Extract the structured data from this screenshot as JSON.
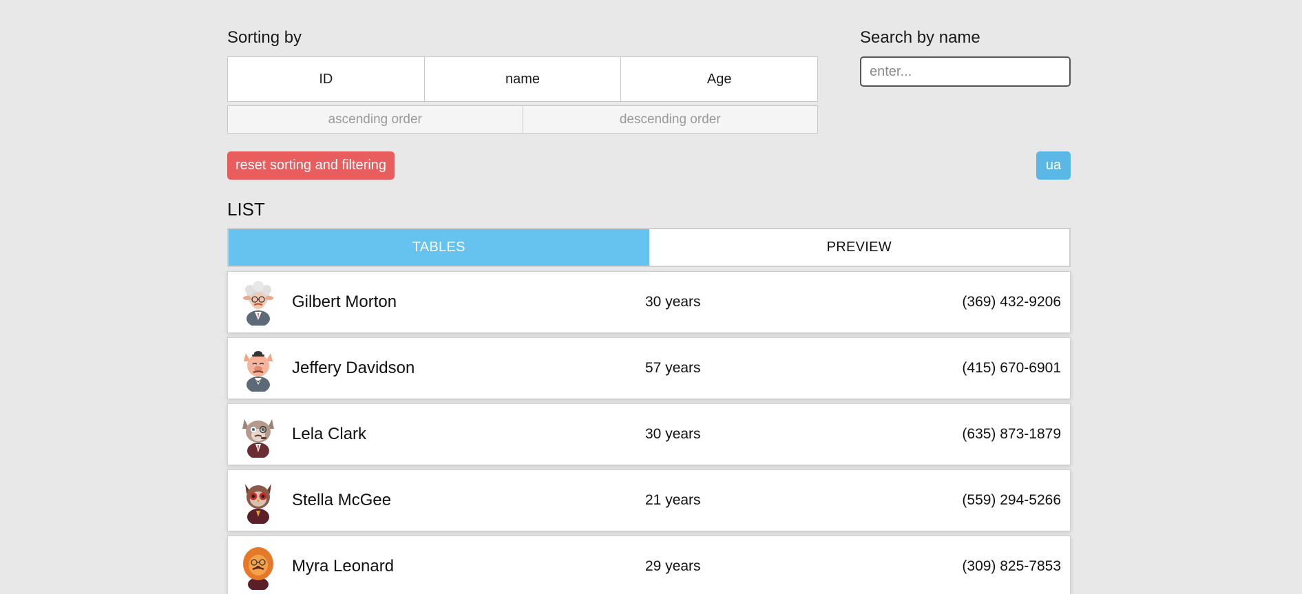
{
  "sorting": {
    "title": "Sorting by",
    "fields": [
      "ID",
      "name",
      "Age"
    ],
    "orders": [
      "ascending order",
      "descending order"
    ]
  },
  "search": {
    "title": "Search by name",
    "placeholder": "enter...",
    "value": ""
  },
  "controls": {
    "reset_label": "reset sorting and filtering",
    "lang_label": "ua"
  },
  "list": {
    "title": "LIST",
    "tabs": [
      {
        "label": "TABLES",
        "active": true
      },
      {
        "label": "PREVIEW",
        "active": false
      }
    ],
    "rows": [
      {
        "name": "Gilbert Morton",
        "age": "30 years",
        "phone": "(369) 432-9206",
        "avatar": "sheep-avatar-icon"
      },
      {
        "name": "Jeffery Davidson",
        "age": "57 years",
        "phone": "(415) 670-6901",
        "avatar": "pig-avatar-icon"
      },
      {
        "name": "Lela Clark",
        "age": "30 years",
        "phone": "(635) 873-1879",
        "avatar": "cat-avatar-icon"
      },
      {
        "name": "Stella McGee",
        "age": "21 years",
        "phone": "(559) 294-5266",
        "avatar": "owl-avatar-icon"
      },
      {
        "name": "Myra Leonard",
        "age": "29 years",
        "phone": "(309) 825-7853",
        "avatar": "lion-avatar-icon"
      }
    ]
  },
  "colors": {
    "background": "#e8e8e8",
    "reset_button": "#e85d5d",
    "lang_button": "#5bb8e6",
    "active_tab": "#66c2ee"
  }
}
